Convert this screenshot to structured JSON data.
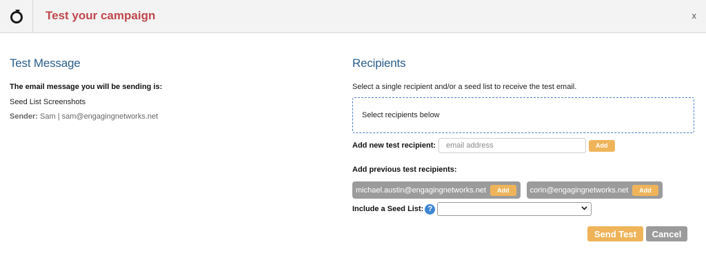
{
  "header": {
    "logo_icon": "logo-ring-icon",
    "title": "Test your campaign",
    "close_label": "x"
  },
  "test_message": {
    "heading": "Test Message",
    "intro": "The email message you will be sending is:",
    "subject": "Seed List Screenshots",
    "sender_label": "Sender:",
    "sender_value": "Sam | sam@engagingnetworks.net"
  },
  "recipients": {
    "heading": "Recipients",
    "hint": "Select a single recipient and/or a seed list to receive the test email.",
    "dropzone_text": "Select recipients below",
    "new_label": "Add new test recipient:",
    "new_placeholder": "email address",
    "new_value": "",
    "add_label": "Add",
    "previous_label": "Add previous test recipients:",
    "previous": [
      {
        "email": "michael.austin@engagingnetworks.net",
        "add_label": "Add"
      },
      {
        "email": "corin@engagingnetworks.net",
        "add_label": "Add"
      }
    ],
    "seed_label": "Include a Seed List:",
    "seed_help_icon": "?",
    "seed_selected": ""
  },
  "actions": {
    "send_label": "Send Test",
    "cancel_label": "Cancel"
  },
  "colors": {
    "title": "#c0474d",
    "heading": "#2b5e8c",
    "accent_button": "#efb45a",
    "grey_button": "#9b9b9b",
    "dropzone_border": "#4a7fc4"
  }
}
